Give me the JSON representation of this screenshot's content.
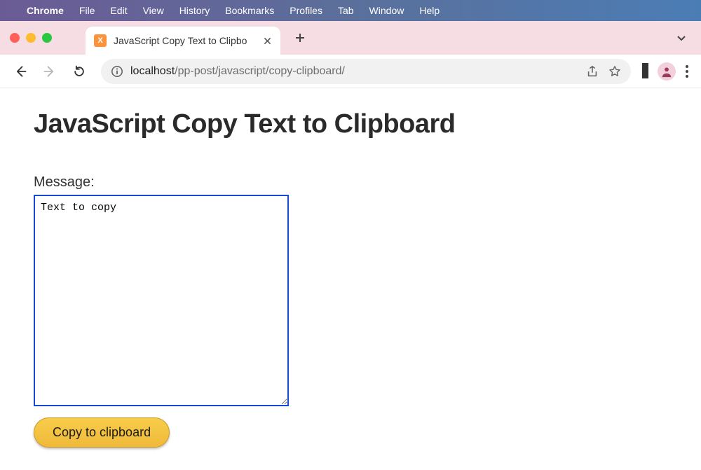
{
  "menubar": {
    "apple_logo": "",
    "app_name": "Chrome",
    "items": [
      "File",
      "Edit",
      "View",
      "History",
      "Bookmarks",
      "Profiles",
      "Tab",
      "Window",
      "Help"
    ]
  },
  "tabstrip": {
    "tab_title": "JavaScript Copy Text to Clipbo",
    "tab_favicon_label": "X"
  },
  "omnibox": {
    "host": "localhost",
    "path": "/pp-post/javascript/copy-clipboard/"
  },
  "page": {
    "heading": "JavaScript Copy Text to Clipboard",
    "form_label": "Message:",
    "textarea_value": "Text to copy",
    "button_label": "Copy to clipboard"
  }
}
